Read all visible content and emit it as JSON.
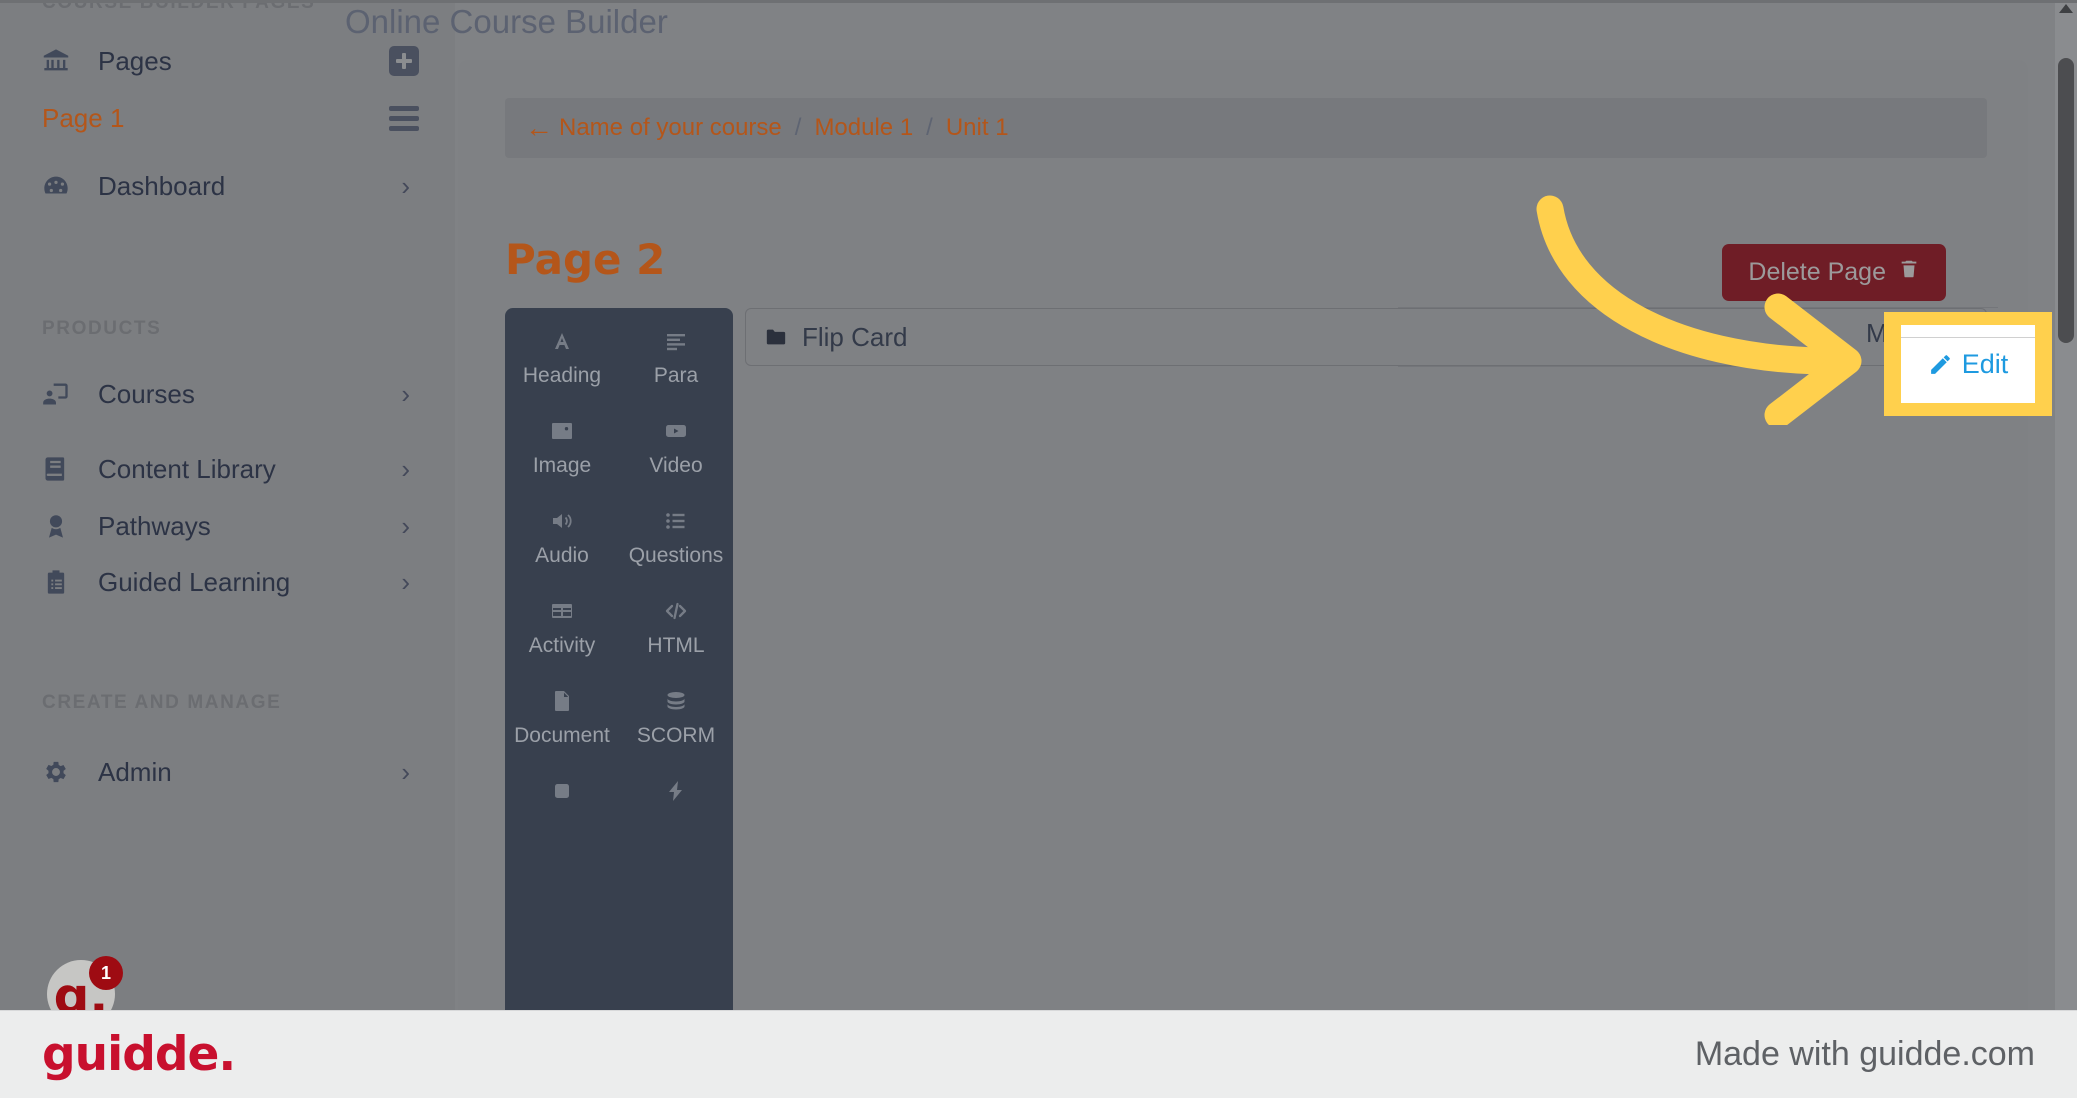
{
  "sidebar": {
    "top_section_label": "COURSE BUILDER PAGES",
    "pages_item": {
      "label": "Pages",
      "icon": "bank-icon",
      "trailing_icon": "plus-icon"
    },
    "page_item": {
      "label": "Page 1",
      "trailing_icon": "hamburger-icon"
    },
    "dashboard_item": {
      "label": "Dashboard",
      "icon": "gauge-icon",
      "chevron": "›"
    },
    "products_label": "PRODUCTS",
    "products_items": [
      {
        "label": "Courses",
        "icon": "presentation-user-icon",
        "chevron": "›"
      },
      {
        "label": "Content Library",
        "icon": "book-icon",
        "chevron": "›"
      },
      {
        "label": "Pathways",
        "icon": "award-icon",
        "chevron": "›"
      },
      {
        "label": "Guided Learning",
        "icon": "clipboard-list-icon",
        "chevron": "›"
      }
    ],
    "create_manage_label": "CREATE AND MANAGE",
    "admin_item": {
      "label": "Admin",
      "icon": "gear-icon",
      "chevron": "›"
    },
    "guidde_badge": {
      "letter": "g.",
      "count": "1"
    }
  },
  "main": {
    "app_title": "Online Course Builder",
    "breadcrumb": {
      "back_arrow": "←",
      "items": [
        "Name of your course",
        "Module 1",
        "Unit 1"
      ],
      "separator": "/"
    },
    "page_heading": "Page 2",
    "delete_button": {
      "label": "Delete Page",
      "icon": "trash-icon"
    },
    "item_row": {
      "label": "Flip Card",
      "icon": "folder-icon"
    },
    "move_label": "Mov"
  },
  "tools": {
    "items": [
      {
        "label": "Heading",
        "icon": "text-a-icon"
      },
      {
        "label": "Para",
        "icon": "paragraph-lines-icon"
      },
      {
        "label": "Image",
        "icon": "image-icon"
      },
      {
        "label": "Video",
        "icon": "video-icon"
      },
      {
        "label": "Audio",
        "icon": "audio-speaker-icon"
      },
      {
        "label": "Questions",
        "icon": "list-questions-icon"
      },
      {
        "label": "Activity",
        "icon": "table-grid-icon"
      },
      {
        "label": "HTML",
        "icon": "code-brackets-icon"
      },
      {
        "label": "Document",
        "icon": "document-file-icon"
      },
      {
        "label": "SCORM",
        "icon": "database-stack-icon"
      },
      {
        "label": "",
        "icon": "square-icon"
      },
      {
        "label": "",
        "icon": "lightning-bolt-icon"
      }
    ]
  },
  "annotation": {
    "edit_label": "Edit",
    "edit_icon": "pencil-icon",
    "highlight_color": "#ffd04d",
    "arrow_color": "#ffd04d",
    "edit_text_color": "#1e9ae0"
  },
  "footer": {
    "logo": "guidde.",
    "text": "Made with guidde.com"
  },
  "colors": {
    "accent_orange": "#b4561a",
    "danger_red": "#6f1d26",
    "panel_dark": "#38404e",
    "brand_red": "#c8102e"
  }
}
